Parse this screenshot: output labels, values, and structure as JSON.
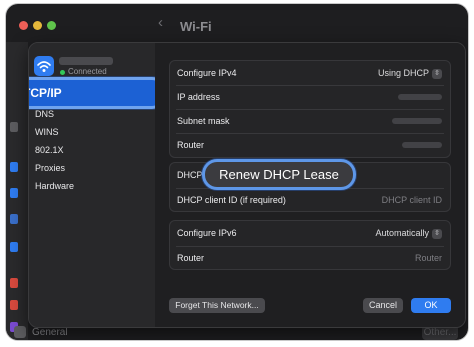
{
  "window": {
    "title": "Wi-Fi",
    "back_icon": "‹"
  },
  "network": {
    "status": "Connected"
  },
  "sidebar": {
    "items": [
      {
        "label": "TCP/IP",
        "selected": true
      },
      {
        "label": "DNS"
      },
      {
        "label": "WINS"
      },
      {
        "label": "802.1X"
      },
      {
        "label": "Proxies"
      },
      {
        "label": "Hardware"
      }
    ]
  },
  "ipv4": {
    "configure_label": "Configure IPv4",
    "configure_value": "Using DHCP",
    "ip_label": "IP address",
    "subnet_label": "Subnet mask",
    "router_label": "Router"
  },
  "dhcp": {
    "lease_label": "DHCP lease",
    "renew_button": "Renew DHCP Lease",
    "client_id_label": "DHCP client ID (if required)",
    "client_id_placeholder": "DHCP client ID"
  },
  "ipv6": {
    "configure_label": "Configure IPv6",
    "configure_value": "Automatically",
    "router_label": "Router",
    "router_value": "Router"
  },
  "footer": {
    "forget_button": "Forget This Network...",
    "cancel_button": "Cancel",
    "ok_button": "OK"
  },
  "background": {
    "general_label": "General",
    "other_button": "Other..."
  },
  "colors": {
    "accent": "#2f7cf0",
    "highlight_ring": "#6fa3ee",
    "connected": "#33c759"
  }
}
